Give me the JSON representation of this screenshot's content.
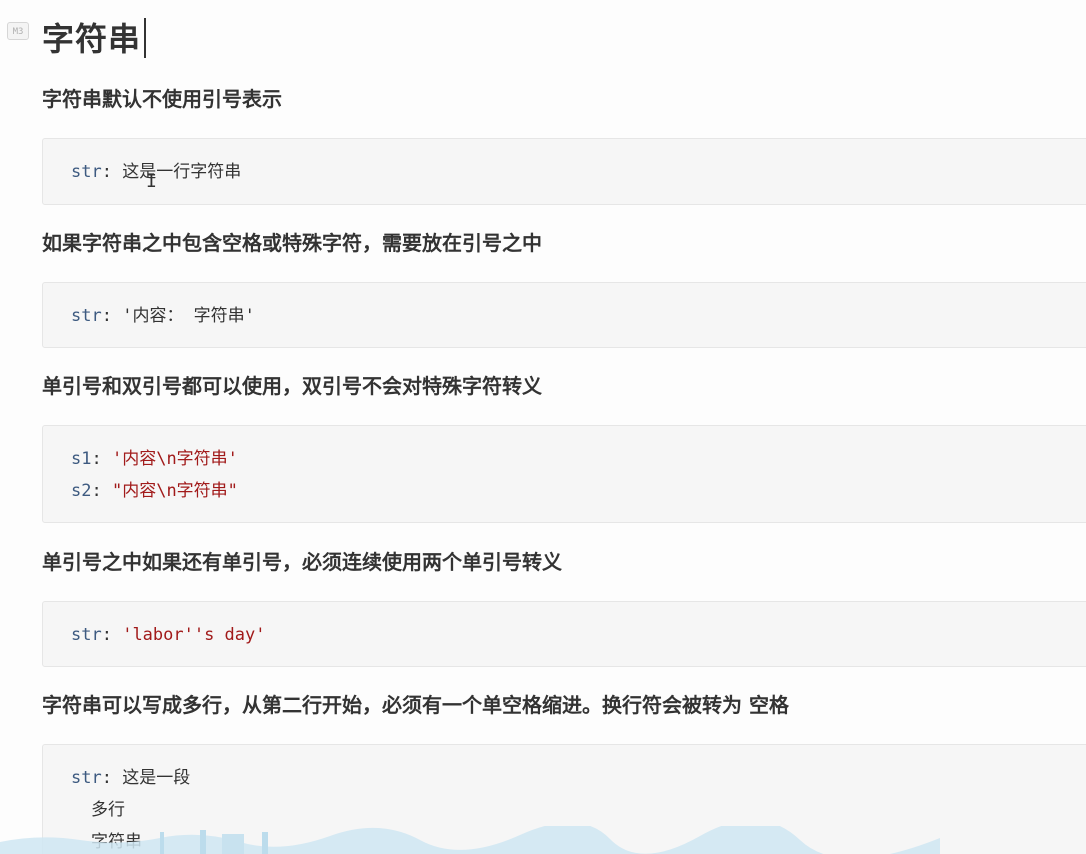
{
  "badge": "M3",
  "title": "字符串",
  "sections": [
    {
      "heading": "字符串默认不使用引号表示",
      "code": [
        {
          "key": "str",
          "sep": ": ",
          "value": "这是一行字符串",
          "value_kind": "plain"
        }
      ]
    },
    {
      "heading": "如果字符串之中包含空格或特殊字符，需要放在引号之中",
      "code": [
        {
          "key": "str",
          "sep": ": ",
          "value": "'内容： 字符串'",
          "value_kind": "plain"
        }
      ]
    },
    {
      "heading": "单引号和双引号都可以使用，双引号不会对特殊字符转义",
      "code": [
        {
          "key": "s1",
          "sep": ": ",
          "value": "'内容\\n字符串'",
          "value_kind": "string"
        },
        {
          "key": "s2",
          "sep": ": ",
          "value": "\"内容\\n字符串\"",
          "value_kind": "string"
        }
      ]
    },
    {
      "heading": "单引号之中如果还有单引号，必须连续使用两个单引号转义",
      "code": [
        {
          "key": "str",
          "sep": ": ",
          "value": "'labor''s day'",
          "value_kind": "string"
        }
      ]
    },
    {
      "heading": "字符串可以写成多行，从第二行开始，必须有一个单空格缩进。换行符会被转为 空格",
      "code": [
        {
          "key": "str",
          "sep": ": ",
          "value": "这是一段",
          "value_kind": "plain"
        }
      ],
      "continuation": [
        "多行",
        "字符串"
      ]
    }
  ],
  "colors": {
    "key": "#3d5a80",
    "string": "#a11a1a",
    "text": "#333333",
    "code_bg": "#f6f6f6"
  }
}
